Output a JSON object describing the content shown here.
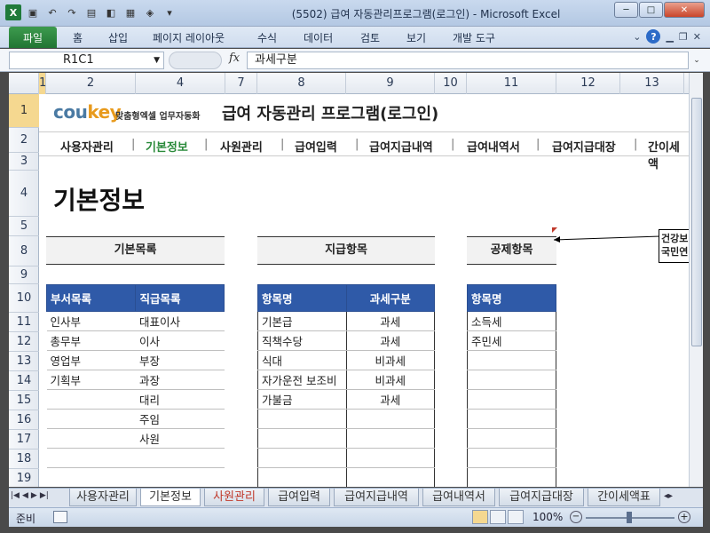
{
  "window": {
    "title": "(5502) 급여 자동관리프로그램(로그인) - Microsoft Excel",
    "minimize": "─",
    "maximize": "□",
    "close": "✕"
  },
  "ribbon": {
    "file": "파일",
    "tabs": [
      "홈",
      "삽입",
      "페이지 레이아웃",
      "수식",
      "데이터",
      "검토",
      "보기",
      "개발 도구"
    ],
    "help": "?"
  },
  "formula_bar": {
    "name_box": "R1C1",
    "fx": "fx",
    "value": "과세구분"
  },
  "columns": [
    "1",
    "2",
    "4",
    "7",
    "8",
    "9",
    "10",
    "11",
    "12",
    "13"
  ],
  "rows": [
    "1",
    "2",
    "3",
    "4",
    "5",
    "8",
    "9",
    "10",
    "11",
    "12",
    "13",
    "14",
    "15",
    "16",
    "17",
    "18",
    "19"
  ],
  "sheet": {
    "logo_brand_a": "cou",
    "logo_brand_b": "key",
    "logo_tagline": "맞춤형엑셀 업무자동화",
    "title": "급여 자동관리 프로그램(로그인)",
    "nav": [
      "사용자관리",
      "기본정보",
      "사원관리",
      "급여입력",
      "급여지급내역",
      "급여내역서",
      "급여지급대장",
      "간이세액"
    ],
    "nav_sep": "|",
    "page_title": "기본정보",
    "basic": {
      "header": "기본목록",
      "col1": "부서목록",
      "col2": "직급목록",
      "rows": [
        [
          "인사부",
          "대표이사"
        ],
        [
          "총무부",
          "이사"
        ],
        [
          "영업부",
          "부장"
        ],
        [
          "기획부",
          "과장"
        ],
        [
          "",
          "대리"
        ],
        [
          "",
          "주임"
        ],
        [
          "",
          "사원"
        ],
        [
          "",
          ""
        ],
        [
          "",
          ""
        ]
      ]
    },
    "pay": {
      "header": "지급항목",
      "col1": "항목명",
      "col2": "과세구분",
      "rows": [
        [
          "기본급",
          "과세"
        ],
        [
          "직책수당",
          "과세"
        ],
        [
          "식대",
          "비과세"
        ],
        [
          "자가운전 보조비",
          "비과세"
        ],
        [
          "가불금",
          "과세"
        ],
        [
          "",
          ""
        ],
        [
          "",
          ""
        ],
        [
          "",
          ""
        ],
        [
          "",
          ""
        ]
      ]
    },
    "deduct": {
      "header": "공제항목",
      "col1": "항목명",
      "rows": [
        "소득세",
        "주민세",
        "",
        "",
        "",
        "",
        "",
        "",
        ""
      ]
    },
    "comment_line1": "건강보",
    "comment_line2": "국민연"
  },
  "sheet_tabs": [
    "사용자관리",
    "기본정보",
    "사원관리",
    "급여입력",
    "급여지급내역",
    "급여내역서",
    "급여지급대장",
    "간이세액표"
  ],
  "status": {
    "ready": "준비",
    "zoom": "100%",
    "minus": "−",
    "plus": "+"
  }
}
